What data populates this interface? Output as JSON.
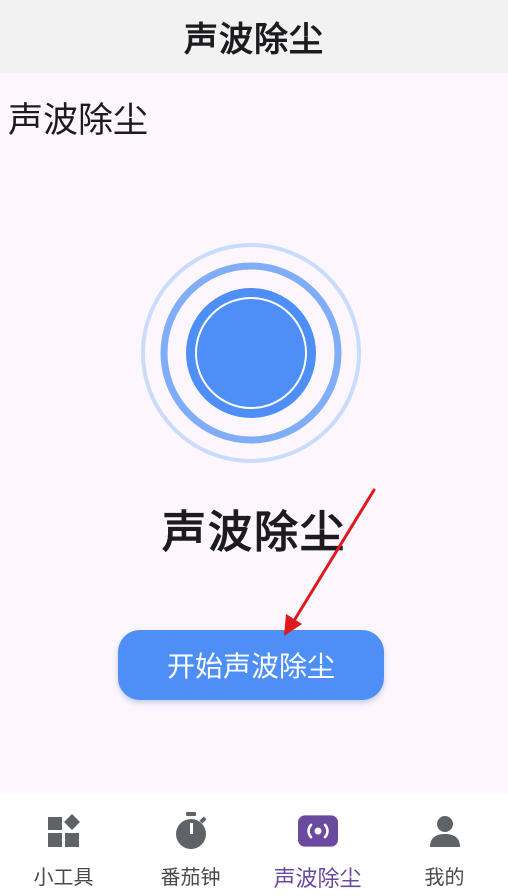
{
  "app_bar": {
    "title": "声波除尘"
  },
  "page": {
    "heading": "声波除尘",
    "feature_title": "声波除尘",
    "start_button_label": "开始声波除尘"
  },
  "colors": {
    "accent": "#4d8ff7",
    "active_nav": "#6a4aa0",
    "annotation_arrow": "#e0191e"
  },
  "bottom_nav": {
    "items": [
      {
        "label": "小工具",
        "icon": "widgets-icon",
        "active": false
      },
      {
        "label": "番茄钟",
        "icon": "timer-icon",
        "active": false
      },
      {
        "label": "声波除尘",
        "icon": "sound-wave-icon",
        "active": true
      },
      {
        "label": "我的",
        "icon": "person-icon",
        "active": false
      }
    ]
  }
}
